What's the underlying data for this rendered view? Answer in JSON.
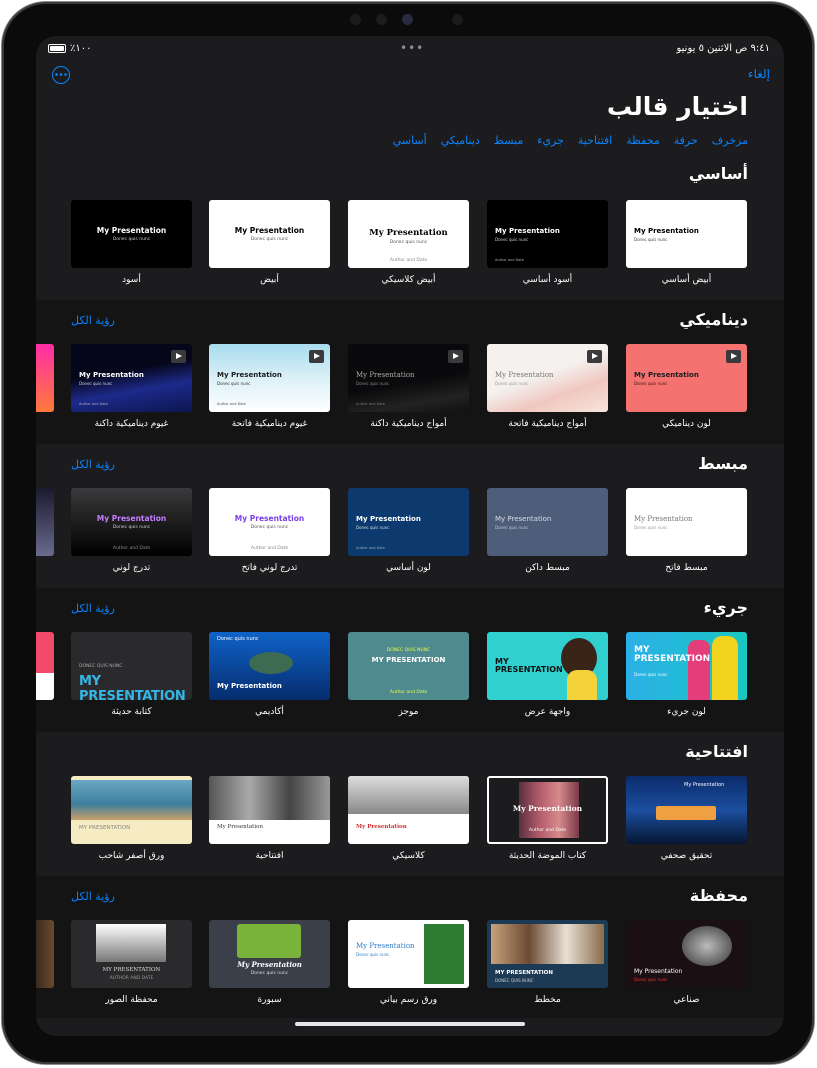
{
  "status": {
    "time": "٩:٤١ ص   الاثنين ٥ يونيو",
    "battery": "٪١٠٠"
  },
  "header": {
    "cancel_label": "إلغاء",
    "title": "اختيار قالب",
    "categories": [
      "أساسي",
      "ديناميكي",
      "مبسط",
      "جريء",
      "افتتاحية",
      "محفظة",
      "حرفة",
      "مزخرف"
    ]
  },
  "see_all_label": "رؤية الكل",
  "sample": {
    "title": "My Presentation",
    "subtitle": "Donec quis nunc",
    "footer": "Author and Date",
    "title_upper": "MY PRESENTATION",
    "sub_upper": "DONEC QUIS NUNC",
    "sub_author": "Donec quis nunc",
    "author_upper": "AUTHOR AND DATE"
  },
  "sections": [
    {
      "title": "أساسي",
      "templates": [
        "أبيض أساسي",
        "أسود أساسي",
        "أبيض كلاسيكي",
        "أبيض",
        "أسود"
      ]
    },
    {
      "title": "ديناميكي",
      "templates": [
        "لون ديناميكي",
        "أمواج ديناميكية فاتحة",
        "أمواج ديناميكية داكنة",
        "غيوم ديناميكية فاتحة",
        "غيوم ديناميكية داكنة"
      ]
    },
    {
      "title": "مبسط",
      "templates": [
        "مبسط فاتح",
        "مبسط داكن",
        "لون أساسي",
        "تدرج لوني فاتح",
        "تدرج لوني"
      ]
    },
    {
      "title": "جريء",
      "templates": [
        "لون جريء",
        "واجهة عرض",
        "موجز",
        "أكاديمي",
        "كتابة حديثة"
      ]
    },
    {
      "title": "افتتاحية",
      "templates": [
        "تحقيق صحفي",
        "كتاب الموضة الحديثة",
        "كلاسيكي",
        "افتتاحية",
        "ورق أصفر شاحب"
      ]
    },
    {
      "title": "محفظة",
      "templates": [
        "صناعي",
        "مخطط",
        "ورق رسم بياني",
        "سبورة",
        "محفظة الصور"
      ]
    }
  ],
  "colors": {
    "accent": "#0a84ff",
    "background": "#1c1c1e",
    "alt_background": "#141415"
  }
}
